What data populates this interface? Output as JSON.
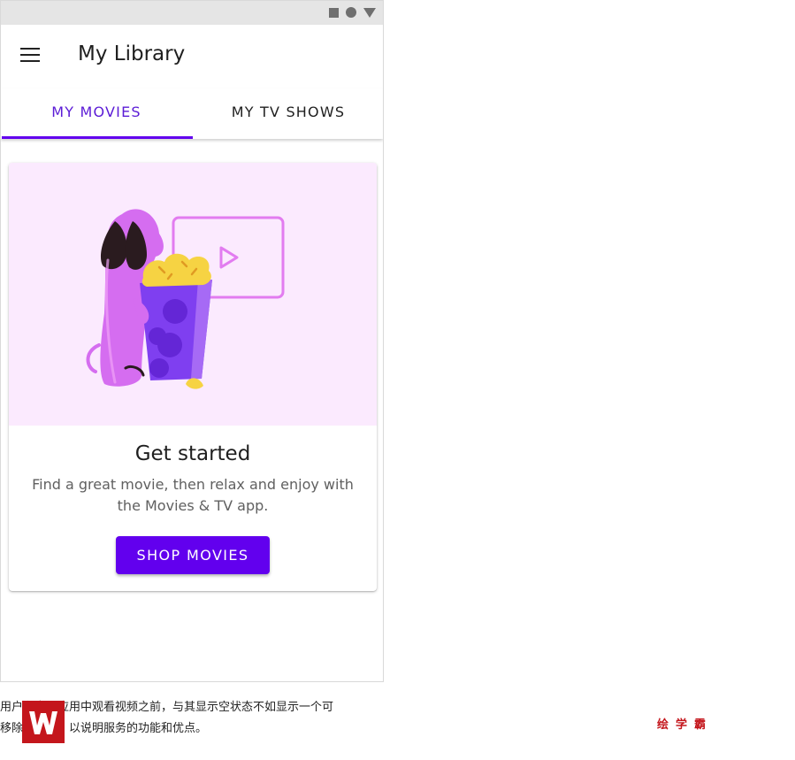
{
  "status_bar": {
    "icons": [
      "square-icon",
      "circle-icon",
      "triangle-icon"
    ]
  },
  "app_bar": {
    "title": "My Library",
    "menu_icon": "menu-icon"
  },
  "tabs": [
    {
      "label": "MY MOVIES",
      "selected": true
    },
    {
      "label": "MY TV SHOWS",
      "selected": false
    }
  ],
  "empty_state": {
    "illustration": "dog-with-popcorn-and-video-screen",
    "title": "Get started",
    "body": "Find a great movie, then relax and enjoy with the Movies & TV app.",
    "button_label": "SHOP MOVIES"
  },
  "caption": {
    "line1": "用户在电影应用中观看视频之前，与其显示空状态不如显示一个可",
    "line2": "移除的图片，以说明服务的功能和优点。"
  },
  "brand": {
    "name": "绘学霸"
  },
  "colors": {
    "primary": "#6200ee",
    "selected_tab_text": "#5b1bd6",
    "illustration_background": "#fbeafe",
    "status_bar": "#e5e5e5",
    "brand_red": "#c4161c"
  }
}
